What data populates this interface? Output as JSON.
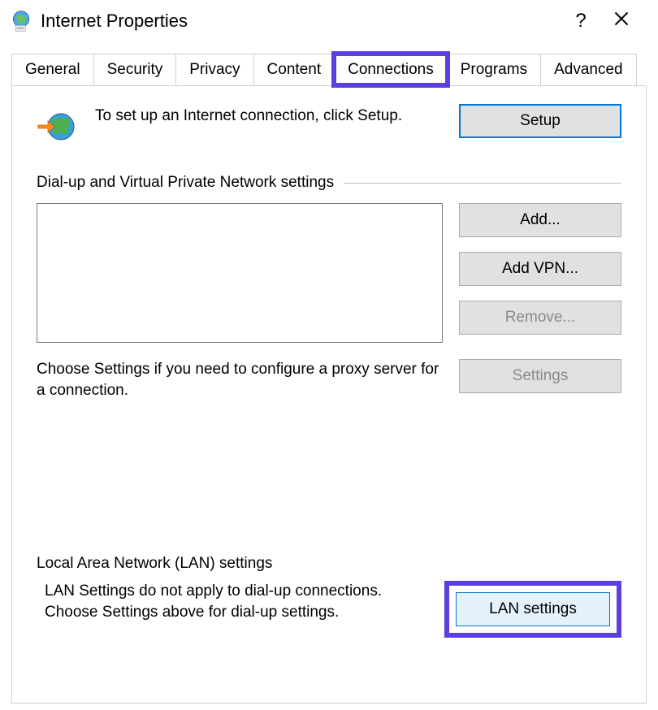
{
  "window": {
    "title": "Internet Properties",
    "help_label": "?",
    "close_label": "Close"
  },
  "tabs": [
    {
      "label": "General",
      "active": false
    },
    {
      "label": "Security",
      "active": false
    },
    {
      "label": "Privacy",
      "active": false
    },
    {
      "label": "Content",
      "active": false
    },
    {
      "label": "Connections",
      "active": true,
      "highlighted": true
    },
    {
      "label": "Programs",
      "active": false
    },
    {
      "label": "Advanced",
      "active": false
    }
  ],
  "setup": {
    "icon": "globe-arrow-icon",
    "text": "To set up an Internet connection, click Setup.",
    "button_label": "Setup"
  },
  "dialup": {
    "header": "Dial-up and Virtual Private Network settings",
    "items": [],
    "buttons": {
      "add": "Add...",
      "add_vpn": "Add VPN...",
      "remove": "Remove...",
      "remove_enabled": false
    },
    "proxy_text": "Choose Settings if you need to configure a proxy server for a connection.",
    "settings_button": "Settings",
    "settings_enabled": false
  },
  "lan": {
    "header": "Local Area Network (LAN) settings",
    "text": "LAN Settings do not apply to dial-up connections. Choose Settings above for dial-up settings.",
    "button_label": "LAN settings",
    "highlighted": true
  }
}
